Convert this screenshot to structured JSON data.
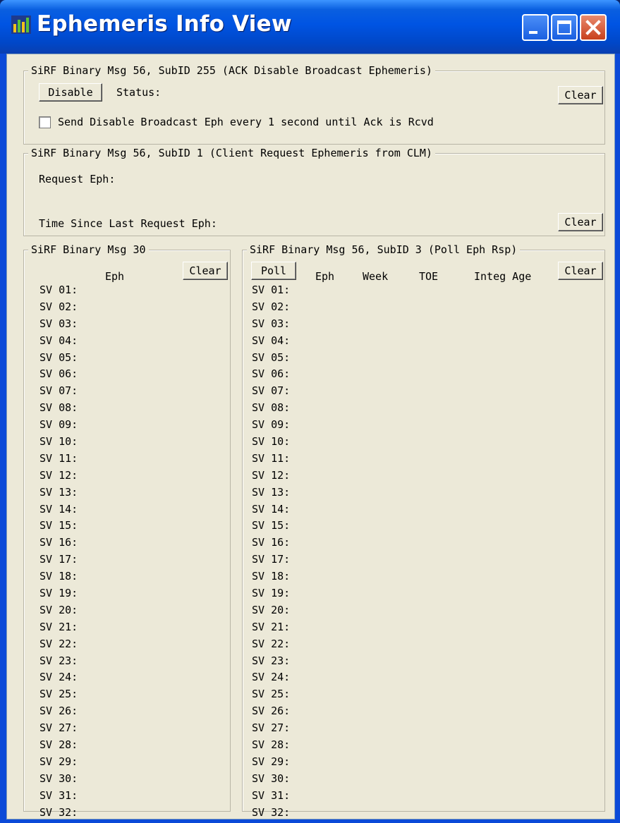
{
  "window": {
    "title": "Ephemeris Info View"
  },
  "group_disable": {
    "legend": "SiRF Binary Msg 56, SubID 255 (ACK Disable Broadcast Ephemeris)",
    "disable_button": "Disable",
    "status_label": "Status:",
    "clear_button": "Clear",
    "checkbox_label": "Send Disable Broadcast Eph every 1 second until Ack is Rcvd",
    "checkbox_checked": false
  },
  "group_request": {
    "legend": "SiRF Binary Msg 56, SubID 1 (Client Request Ephemeris from CLM)",
    "request_label": "Request Eph:",
    "time_label": "Time Since Last Request Eph:",
    "clear_button": "Clear"
  },
  "group_msg30": {
    "legend": "SiRF Binary Msg 30",
    "col_eph": "Eph",
    "clear_button": "Clear"
  },
  "group_poll": {
    "legend": "SiRF Binary Msg 56, SubID 3 (Poll Eph Rsp)",
    "poll_button": "Poll",
    "col_eph": "Eph",
    "col_week": "Week",
    "col_toe": "TOE",
    "col_integ_age": "Integ Age",
    "clear_button": "Clear"
  },
  "sv_labels": [
    "SV 01:",
    "SV 02:",
    "SV 03:",
    "SV 04:",
    "SV 05:",
    "SV 06:",
    "SV 07:",
    "SV 08:",
    "SV 09:",
    "SV 10:",
    "SV 11:",
    "SV 12:",
    "SV 13:",
    "SV 14:",
    "SV 15:",
    "SV 16:",
    "SV 17:",
    "SV 18:",
    "SV 19:",
    "SV 20:",
    "SV 21:",
    "SV 22:",
    "SV 23:",
    "SV 24:",
    "SV 25:",
    "SV 26:",
    "SV 27:",
    "SV 28:",
    "SV 29:",
    "SV 30:",
    "SV 31:",
    "SV 32:"
  ],
  "colors": {
    "titlebar": "#0054e3",
    "client_bg": "#ece9d8",
    "close_button": "#c8401c"
  },
  "icons": {
    "app": "bar-chart-icon",
    "minimize": "minimize-icon",
    "maximize": "maximize-icon",
    "close": "close-icon"
  }
}
